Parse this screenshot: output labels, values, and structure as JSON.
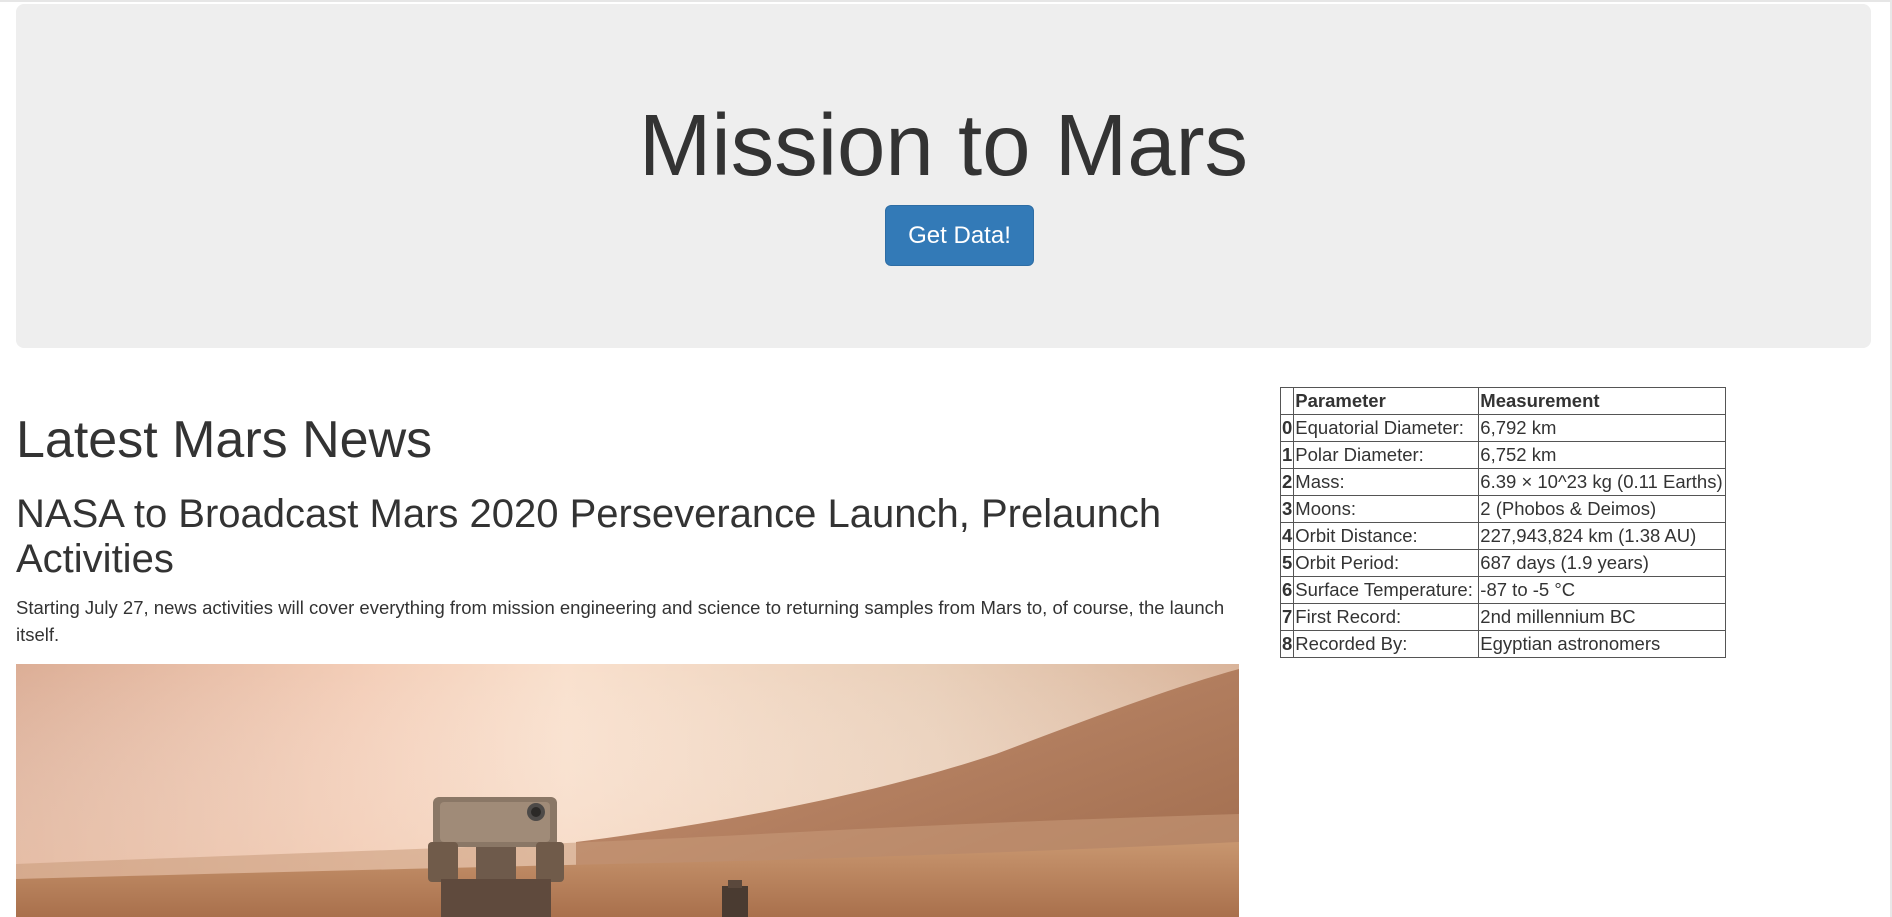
{
  "jumbotron": {
    "title": "Mission to Mars",
    "button_label": "Get Data!"
  },
  "news": {
    "section_heading": "Latest Mars News",
    "title": "NASA to Broadcast Mars 2020 Perseverance Launch, Prelaunch Activities",
    "paragraph": "Starting July 27, news activities will cover everything from mission engineering and science to returning samples from Mars to, of course, the launch itself."
  },
  "facts": {
    "headers": [
      "",
      "Parameter",
      "Measurement"
    ],
    "rows": [
      {
        "index": "0",
        "parameter": "Equatorial Diameter:",
        "measurement": "6,792 km"
      },
      {
        "index": "1",
        "parameter": "Polar Diameter:",
        "measurement": "6,752 km"
      },
      {
        "index": "2",
        "parameter": "Mass:",
        "measurement": "6.39 × 10^23 kg (0.11 Earths)"
      },
      {
        "index": "3",
        "parameter": "Moons:",
        "measurement": "2 (Phobos & Deimos)"
      },
      {
        "index": "4",
        "parameter": "Orbit Distance:",
        "measurement": "227,943,824 km (1.38 AU)"
      },
      {
        "index": "5",
        "parameter": "Orbit Period:",
        "measurement": "687 days (1.9 years)"
      },
      {
        "index": "6",
        "parameter": "Surface Temperature:",
        "measurement": "-87 to -5 °C"
      },
      {
        "index": "7",
        "parameter": "First Record:",
        "measurement": "2nd millennium BC"
      },
      {
        "index": "8",
        "parameter": "Recorded By:",
        "measurement": "Egyptian astronomers"
      }
    ]
  },
  "colors": {
    "jumbotron_bg": "#eeeeee",
    "button_bg": "#337ab7",
    "text": "#333333"
  }
}
